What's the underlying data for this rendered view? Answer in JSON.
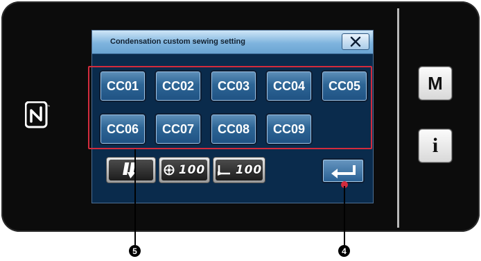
{
  "dialog": {
    "title": "Condensation custom sewing setting",
    "close_icon": "close-x-icon"
  },
  "patterns": [
    {
      "label": "CC01"
    },
    {
      "label": "CC02"
    },
    {
      "label": "CC03"
    },
    {
      "label": "CC04"
    },
    {
      "label": "CC05"
    },
    {
      "label": "CC06"
    },
    {
      "label": "CC07"
    },
    {
      "label": "CC08"
    },
    {
      "label": "CC09"
    }
  ],
  "statusbar": {
    "feed_icon": "stitch-feed-icon",
    "speed_icon": "sewing-speed-icon",
    "speed_value": "100",
    "length_icon": "stitch-length-icon",
    "length_value": "100"
  },
  "side_buttons": {
    "mode_label": "M",
    "info_label": "i"
  },
  "enter_icon": "enter-arrow-icon",
  "nfc_icon": "nfc-logo-icon",
  "callouts": {
    "pattern_area": "5",
    "enter": "4"
  },
  "colors": {
    "highlight": "#d32b3d",
    "button": "#2d6595",
    "titlebar": "#7fb4de"
  }
}
